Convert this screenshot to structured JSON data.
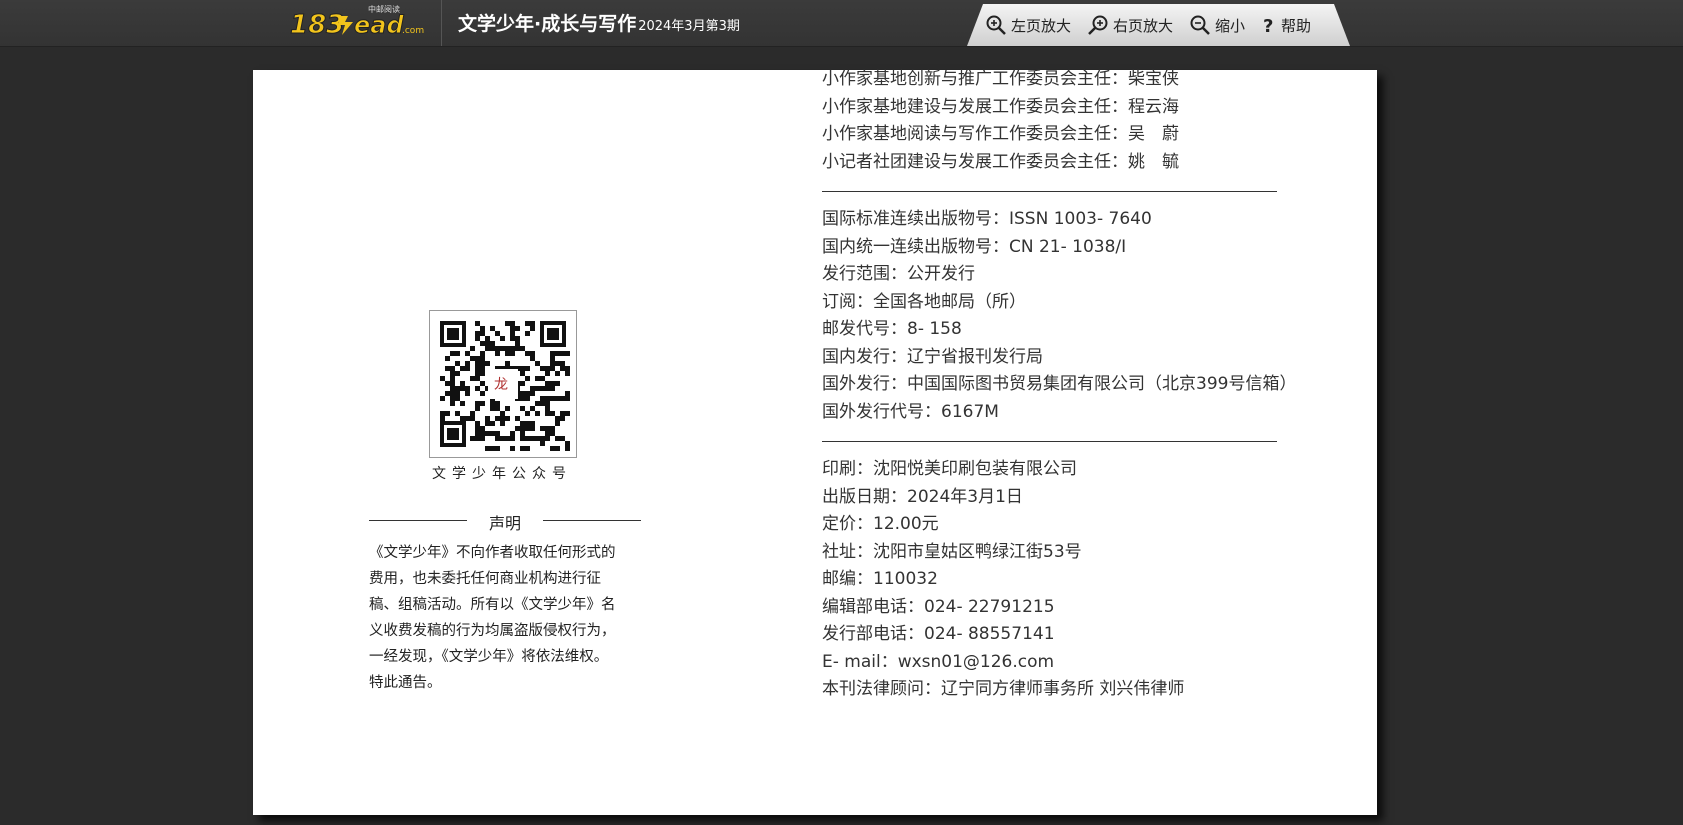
{
  "header": {
    "logo_alt": "183read",
    "title": "文学少年·成长与写作",
    "issue": "2024年3月第3期"
  },
  "toolbar": {
    "left_zoom": "左页放大",
    "right_zoom": "右页放大",
    "zoom_out": "缩小",
    "help": "帮助"
  },
  "left_page": {
    "qr_caption": "文学少年公众号",
    "statement_title": "声明",
    "statement_lines": [
      "《文学少年》不向作者收取任何形式的",
      "费用，也未委托任何商业机构进行征",
      "稿、组稿活动。所有以《文学少年》名",
      "义收费发稿的行为均属盗版侵权行为，",
      "一经发现，《文学少年》将依法维权。",
      "特此通告。"
    ]
  },
  "right_page": {
    "committee": [
      "小作家基地创新与推广工作委员会主任：柴宝侠",
      "小作家基地建设与发展工作委员会主任：程云海",
      "小作家基地阅读与写作工作委员会主任：吴　蔚",
      "小记者社团建设与发展工作委员会主任：姚　毓"
    ],
    "publication": [
      "国际标准连续出版物号：ISSN 1003- 7640",
      "国内统一连续出版物号：CN 21- 1038/I",
      "发行范围：公开发行",
      "订阅：全国各地邮局（所）",
      "邮发代号：8- 158",
      "国内发行：辽宁省报刊发行局",
      "国外发行：中国国际图书贸易集团有限公司（北京399号信箱）",
      "国外发行代号：6167M"
    ],
    "contact": [
      "印刷：沈阳悦美印刷包装有限公司",
      "出版日期：2024年3月1日",
      "定价：12.00元",
      "社址：沈阳市皇姑区鸭绿江街53号",
      "邮编：110032",
      "编辑部电话：024- 22791215",
      "发行部电话：024- 88557141",
      "E- mail：wxsn01@126.com",
      "本刊法律顾问：辽宁同方律师事务所  刘兴伟律师"
    ]
  }
}
